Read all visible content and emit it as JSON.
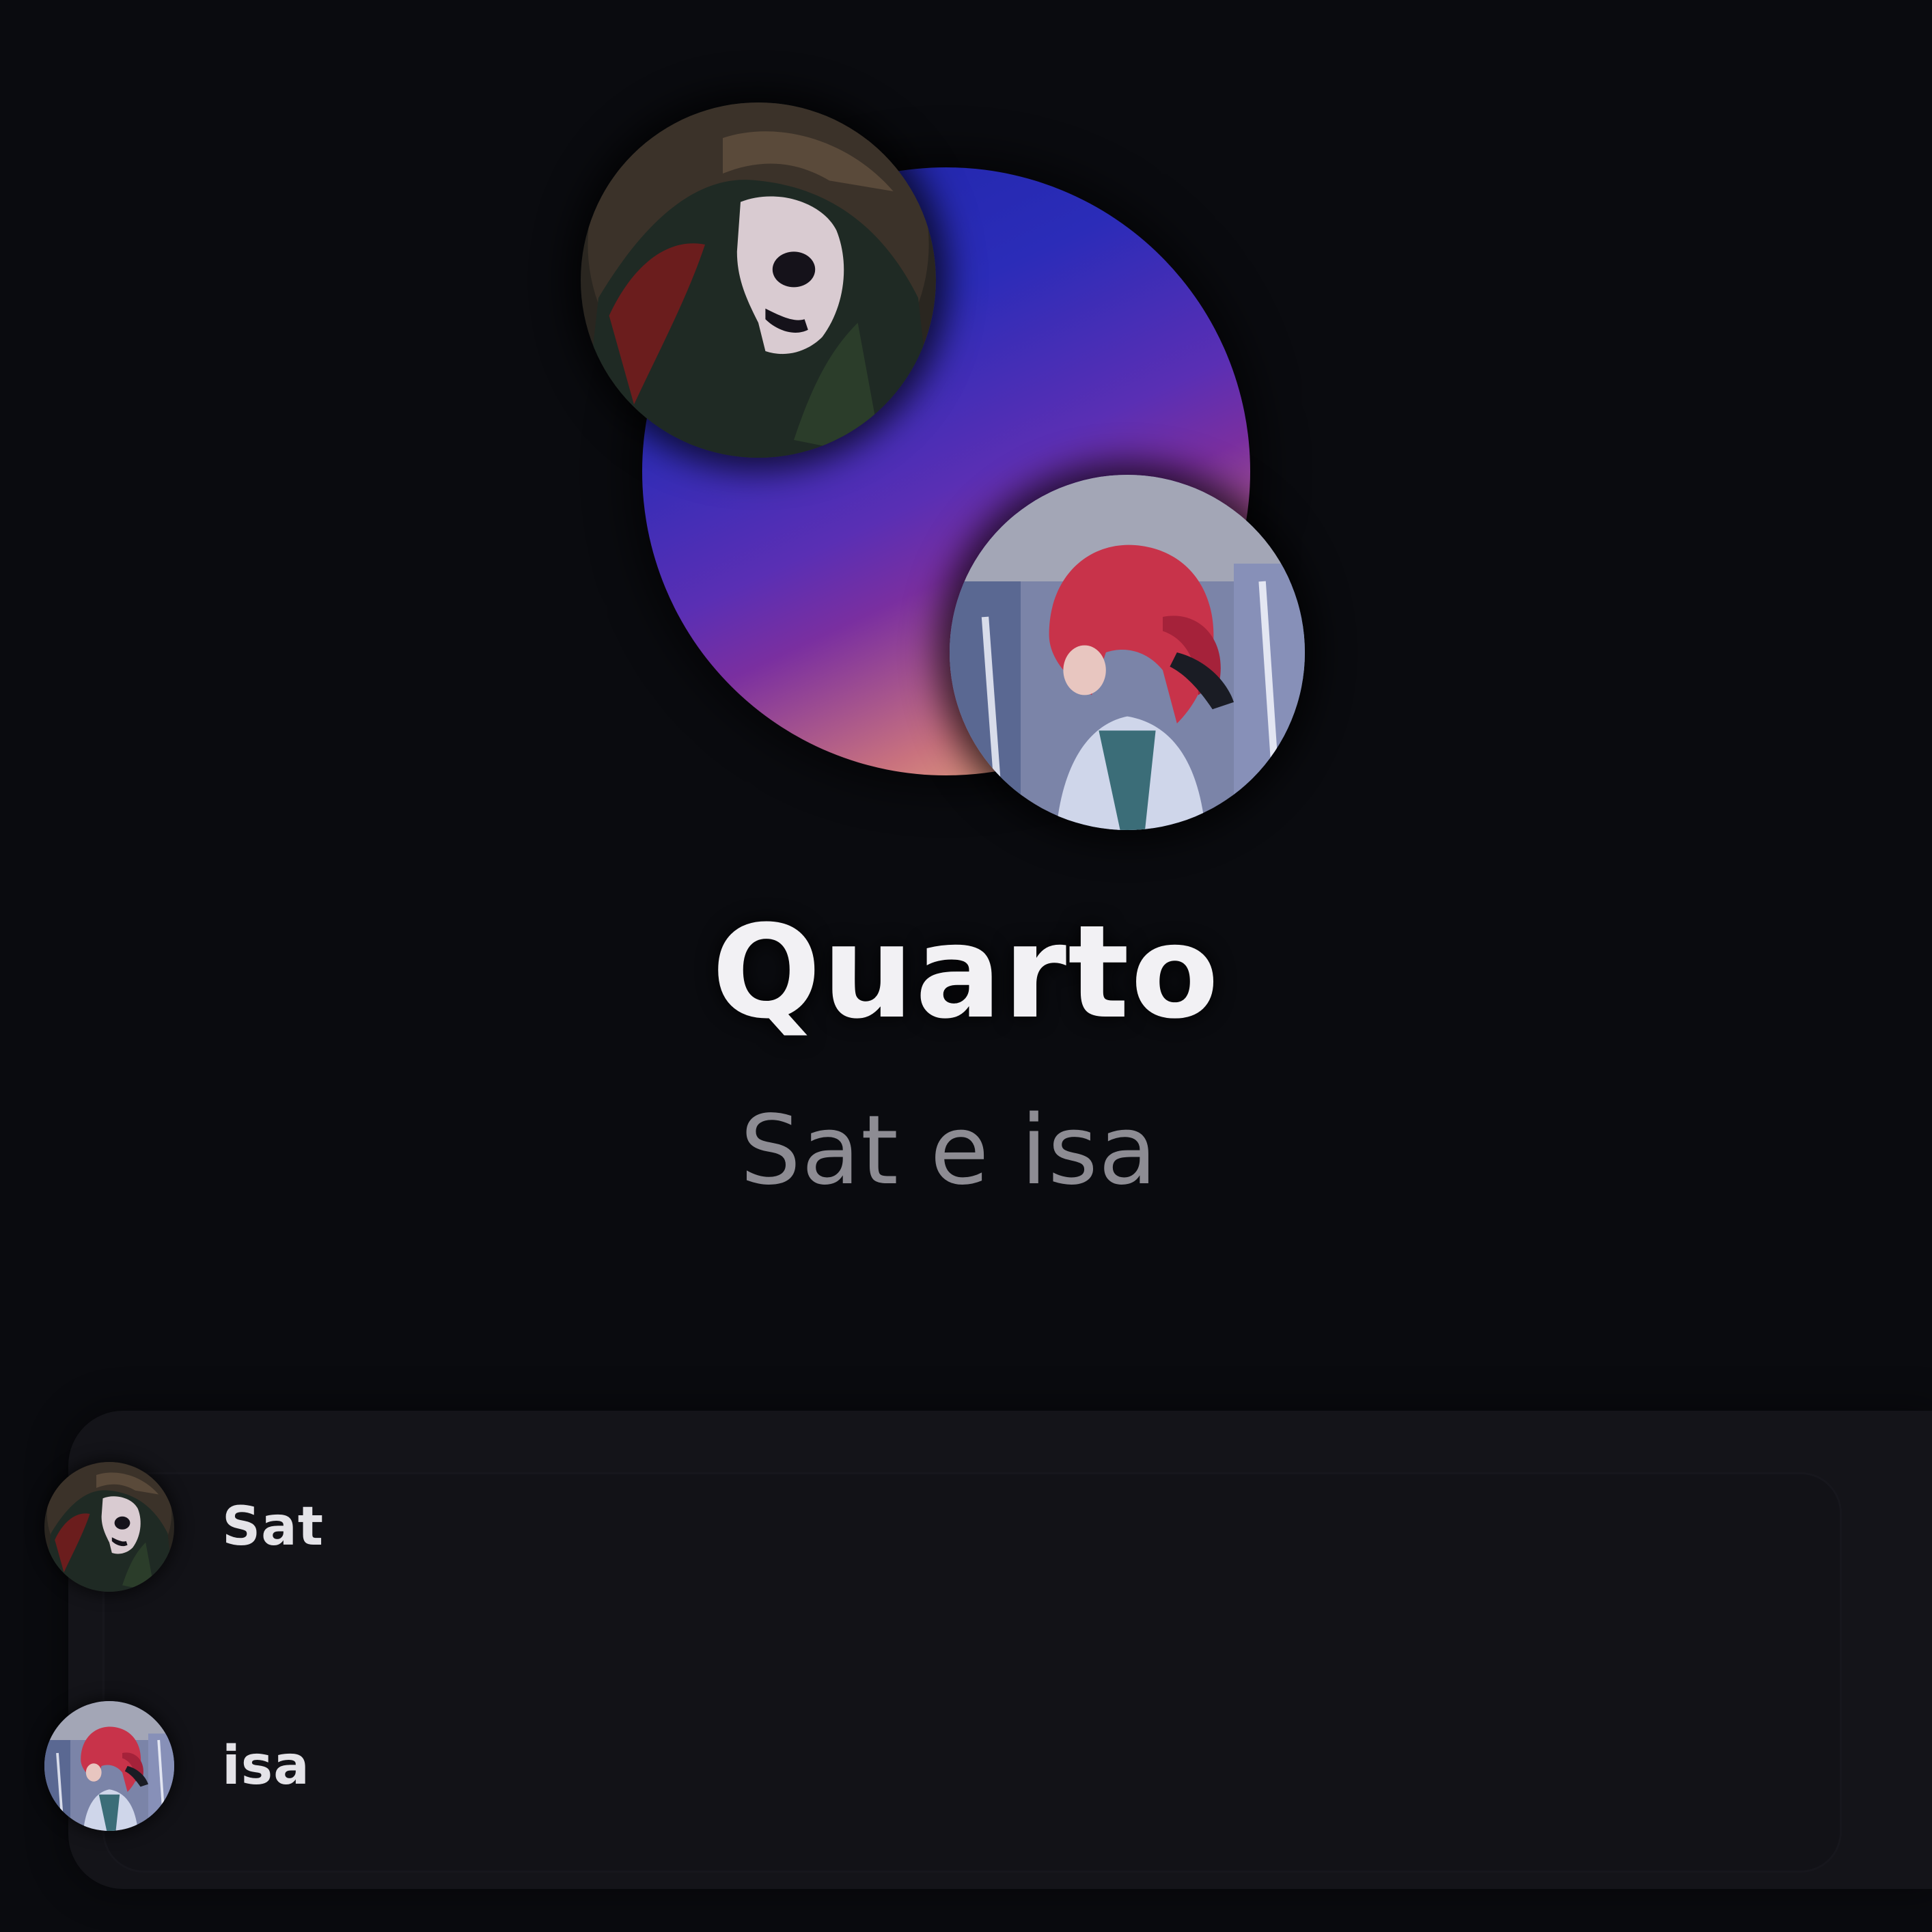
{
  "group": {
    "name": "Quarto",
    "subtitle": "Sat e isa",
    "gradient_colors": [
      "#1e25a8",
      "#5a2fb4",
      "#7a2fa0",
      "#ffd57e"
    ]
  },
  "members": [
    {
      "name": "Sat",
      "avatar_icon": "dark-masked-figure-avatar"
    },
    {
      "name": "isa",
      "avatar_icon": "red-haired-anime-avatar"
    }
  ],
  "colors": {
    "background": "#0a0b0f",
    "card": "#141419",
    "title": "#f2f1f4",
    "subtitle": "#8d8c93"
  }
}
